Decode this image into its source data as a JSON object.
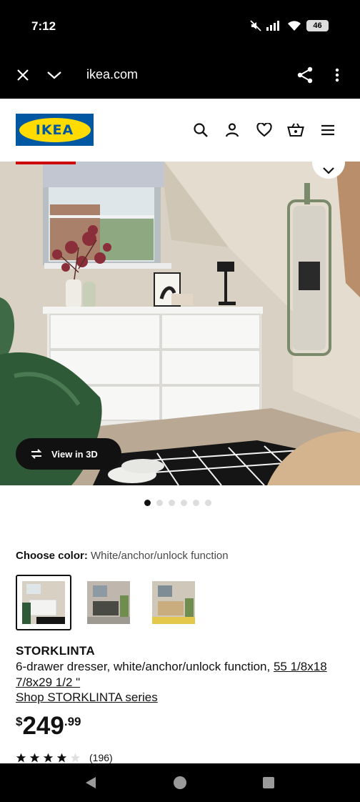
{
  "status_bar": {
    "time": "7:12",
    "battery": "46"
  },
  "browser": {
    "url": "ikea.com"
  },
  "header": {
    "logo_text": "IKEA"
  },
  "gallery": {
    "view_3d_label": "View in 3D",
    "dot_count": 6,
    "active_dot": 0
  },
  "color": {
    "label": "Choose color:",
    "value": "White/anchor/unlock function",
    "swatches": [
      "white",
      "black-brown",
      "oak"
    ]
  },
  "product": {
    "name": "STORKLINTA",
    "description": "6-drawer dresser, white/anchor/unlock function, ",
    "size": "55 1/8x18 7/8x29 1/2 \"",
    "series_link": "Shop STORKLINTA series",
    "price_currency": "$",
    "price_int": "249",
    "price_dec": ".99",
    "rating_stars": 4,
    "review_count": "(196)"
  },
  "colors": {
    "ikea_blue": "#0058a3",
    "ikea_yellow": "#ffdb00",
    "accent_red": "#cc0008"
  },
  "icons": [
    "close-icon",
    "chevron-down-icon",
    "share-icon",
    "more-vert-icon",
    "search-icon",
    "account-icon",
    "heart-icon",
    "cart-icon",
    "menu-icon",
    "rotate-3d-icon"
  ]
}
